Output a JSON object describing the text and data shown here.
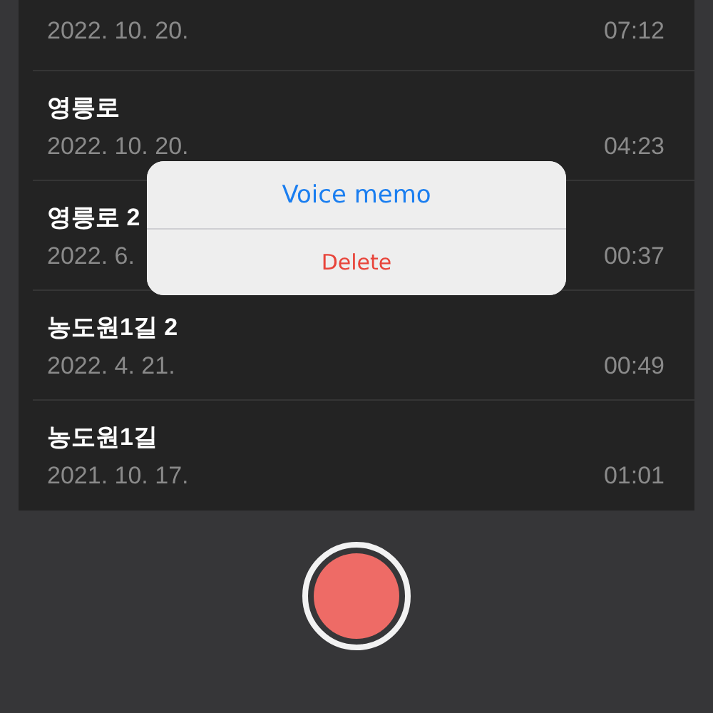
{
  "recordings": [
    {
      "date": "2022. 10. 20.",
      "duration": "07:12"
    },
    {
      "title": "영릉로",
      "date": "2022. 10. 20.",
      "duration": "04:23"
    },
    {
      "title": "영릉로 2",
      "date": "2022. 6.",
      "duration": "00:37"
    },
    {
      "title": "농도원1길 2",
      "date": "2022. 4. 21.",
      "duration": "00:49"
    },
    {
      "title": "농도원1길",
      "date": "2021. 10. 17.",
      "duration": "01:01"
    }
  ],
  "action_sheet": {
    "actions": [
      {
        "label": "Voice memo",
        "kind": "default"
      },
      {
        "label": "Delete",
        "kind": "destructive"
      }
    ]
  },
  "record_button": {
    "kind": "idle"
  }
}
